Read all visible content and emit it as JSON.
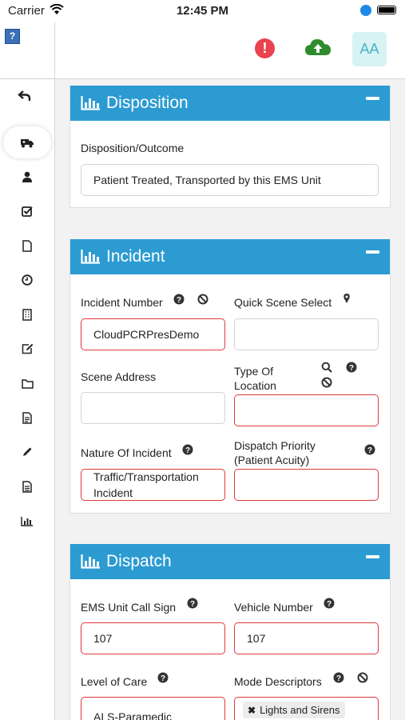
{
  "status": {
    "carrier": "Carrier",
    "time": "12:45 PM"
  },
  "sidebar": {
    "help_icon": "?",
    "items": [
      {
        "icon": "ambulance-icon"
      },
      {
        "icon": "user-icon"
      },
      {
        "icon": "checkbox-icon"
      },
      {
        "icon": "document-icon"
      },
      {
        "icon": "clock-icon"
      },
      {
        "icon": "building-icon"
      },
      {
        "icon": "edit-icon"
      },
      {
        "icon": "folder-icon"
      },
      {
        "icon": "list-document-icon"
      },
      {
        "icon": "pencil-icon"
      },
      {
        "icon": "report-icon"
      },
      {
        "icon": "bar-chart-icon"
      }
    ]
  },
  "topbar": {
    "alert_glyph": "!",
    "font_size_label": "AA"
  },
  "disposition": {
    "title": "Disposition",
    "outcome_label": "Disposition/Outcome",
    "outcome_value": "Patient Treated, Transported by this EMS Unit"
  },
  "incident": {
    "title": "Incident",
    "incident_number_label": "Incident Number",
    "incident_number_value": "CloudPCRPresDemo",
    "quick_scene_label": "Quick Scene Select",
    "scene_address_label": "Scene Address",
    "type_of_location_label": "Type Of Location",
    "nature_label": "Nature Of Incident",
    "nature_value": "Traffic/Transportation Incident",
    "dispatch_priority_label": "Dispatch Priority (Patient Acuity)"
  },
  "dispatch": {
    "title": "Dispatch",
    "call_sign_label": "EMS Unit Call Sign",
    "call_sign_value": "107",
    "vehicle_label": "Vehicle Number",
    "vehicle_value": "107",
    "level_label": "Level of Care",
    "level_value": "ALS-Paramedic",
    "mode_label": "Mode Descriptors",
    "mode_tag": "Lights and Sirens"
  },
  "colors": {
    "header_blue": "#2c9bd2",
    "required_red": "#e0383e",
    "alert_red": "#e8434f",
    "cloud_green": "#2e8b2e"
  }
}
